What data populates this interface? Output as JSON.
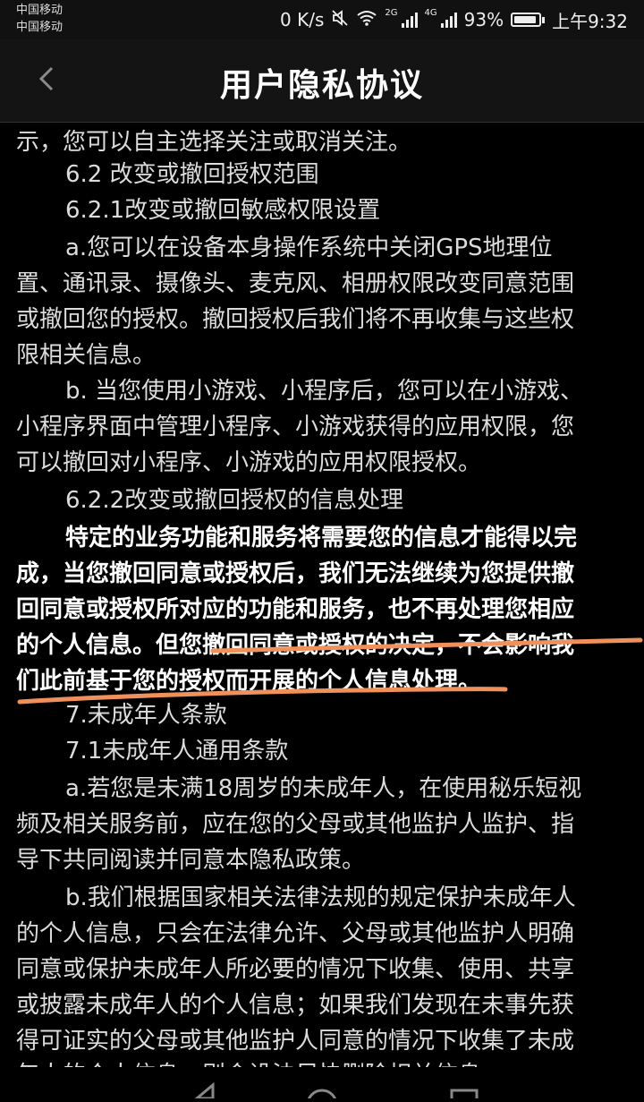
{
  "status_bar": {
    "carrier_1": "中国移动",
    "carrier_2": "中国移动",
    "speed": "0 K/s",
    "sim1_type": "2G",
    "sim2_type": "4G",
    "battery": "93%",
    "battery_level": 0.93,
    "time": "上午9:32",
    "icons": [
      "mute-icon",
      "wifi-icon",
      "signal-icon",
      "battery-icon"
    ]
  },
  "header": {
    "title": "用户隐私协议",
    "back_icon": "chevron-left-icon"
  },
  "document": {
    "lines": [
      {
        "text": "示，您可以自主选择关注或取消关注。",
        "indent": false,
        "bold": false
      },
      {
        "text": "6.2 改变或撤回授权范围",
        "indent": true,
        "bold": false
      },
      {
        "text": "6.2.1改变或撤回敏感权限设置",
        "indent": true,
        "bold": false
      },
      {
        "text": "a.您可以在设备本身操作系统中关闭GPS地理位",
        "indent": true,
        "bold": false
      },
      {
        "text": "置、通讯录、摄像头、麦克风、相册权限改变同意范围",
        "indent": false,
        "bold": false
      },
      {
        "text": "或撤回您的授权。撤回授权后我们将不再收集与这些权",
        "indent": false,
        "bold": false
      },
      {
        "text": "限相关信息。",
        "indent": false,
        "bold": false
      },
      {
        "text": "b. 当您使用小游戏、小程序后，您可以在小游戏、",
        "indent": true,
        "bold": false
      },
      {
        "text": "小程序界面中管理小程序、小游戏获得的应用权限，您",
        "indent": false,
        "bold": false
      },
      {
        "text": "可以撤回对小程序、小游戏的应用权限授权。",
        "indent": false,
        "bold": false
      },
      {
        "text": "6.2.2改变或撤回授权的信息处理",
        "indent": true,
        "bold": false
      },
      {
        "text": "特定的业务功能和服务将需要您的信息才能得以完",
        "indent": true,
        "bold": true
      },
      {
        "text": "成，当您撤回同意或授权后，我们无法继续为您提供撤",
        "indent": false,
        "bold": true
      },
      {
        "text": "回同意或授权所对应的功能和服务，也不再处理您相应",
        "indent": false,
        "bold": true
      },
      {
        "text": "的个人信息。但您撤回同意或授权的决定，不会影响我",
        "indent": false,
        "bold": true
      },
      {
        "text": "们此前基于您的授权而开展的个人信息处理。",
        "indent": false,
        "bold": true
      },
      {
        "text": "7.未成年人条款",
        "indent": true,
        "bold": false
      },
      {
        "text": "7.1未成年人通用条款",
        "indent": true,
        "bold": false
      },
      {
        "text": "a.若您是未满18周岁的未成年人，在使用秘乐短视",
        "indent": true,
        "bold": false
      },
      {
        "text": "频及相关服务前，应在您的父母或其他监护人监护、指",
        "indent": false,
        "bold": false
      },
      {
        "text": "导下共同阅读并同意本隐私政策。",
        "indent": false,
        "bold": false
      },
      {
        "text": "b.我们根据国家相关法律法规的规定保护未成年人",
        "indent": true,
        "bold": false
      },
      {
        "text": "的个人信息，只会在法律允许、父母或其他监护人明确",
        "indent": false,
        "bold": false
      },
      {
        "text": "同意或保护未成年人所必要的情况下收集、使用、共享",
        "indent": false,
        "bold": false
      },
      {
        "text": "或披露未成年人的个人信息；如果我们发现在未事先获",
        "indent": false,
        "bold": false
      },
      {
        "text": "得可证实的父母或其他监护人同意的情况下收集了未成",
        "indent": false,
        "bold": false
      },
      {
        "text": "年人的个人信息，则会设法尽快删除相关信息。",
        "indent": false,
        "bold": false
      }
    ]
  },
  "annotation": {
    "color": "#f0905a"
  },
  "nav_bar_icons": [
    "back-triangle-icon",
    "home-circle-icon",
    "recents-square-icon"
  ]
}
